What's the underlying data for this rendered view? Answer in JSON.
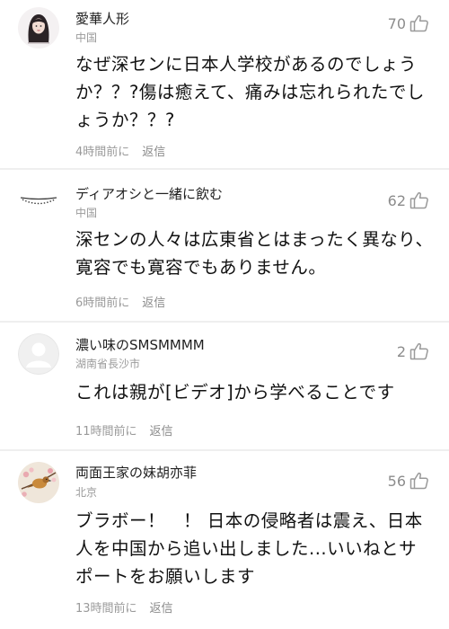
{
  "colors": {
    "background": "#ffffff",
    "divider": "#efefef",
    "secondary_text": "#9a9a9a",
    "primary_text": "#111111"
  },
  "comments": [
    {
      "username": "愛華人形",
      "location": "中国",
      "likes": "70",
      "text": "なぜ深センに日本人学校があるのでしょうか？？?傷は癒えて、痛みは忘れられたでしょうか？？?",
      "time": "4時間前に",
      "reply": "返信",
      "avatar_icon": "girl-portrait-avatar-icon"
    },
    {
      "username": "ディアオシと一緒に飲む",
      "location": "中国",
      "likes": "62",
      "text": "深センの人々は広東省とはまったく異なり、寛容でも寛容でもありません。",
      "time": "6時間前に",
      "reply": "返信",
      "avatar_icon": "dotted-smile-avatar-icon"
    },
    {
      "username": "濃い味のSMSMMMM",
      "location": "湖南省長沙市",
      "likes": "2",
      "text": "これは親が[ビデオ]から学べることです",
      "time": "11時間前に",
      "reply": "返信",
      "avatar_icon": "default-person-avatar-icon"
    },
    {
      "username": "両面王家の妹胡亦菲",
      "location": "北京",
      "likes": "56",
      "text": "ブラボー！　！ 日本の侵略者は震え、日本人を中国から追い出しました...いいねとサポートをお願いします",
      "time": "13時間前に",
      "reply": "返信",
      "avatar_icon": "bird-blossom-avatar-icon"
    }
  ]
}
